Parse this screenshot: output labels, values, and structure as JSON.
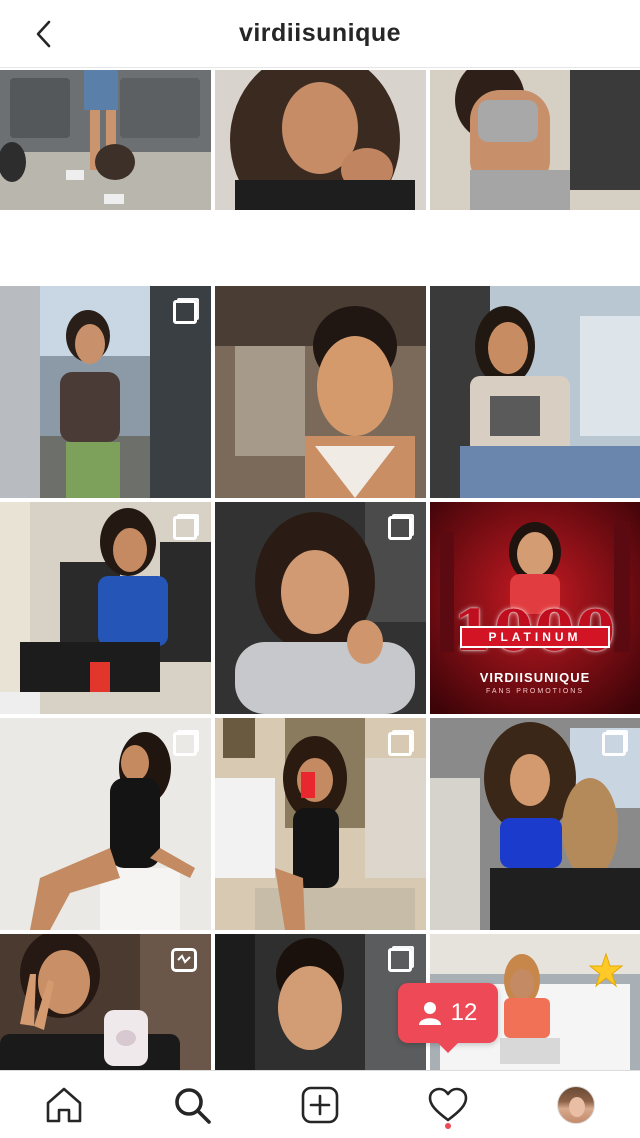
{
  "header": {
    "title": "virdiisunique"
  },
  "posts": [
    {
      "scene": "car-door-legs",
      "badge": "none"
    },
    {
      "scene": "curly-hair-selfie",
      "badge": "none"
    },
    {
      "scene": "gray-tank-top",
      "badge": "none"
    },
    {
      "scene": "truck-crop-top",
      "badge": "multiple"
    },
    {
      "scene": "car-selfie-bun",
      "badge": "none"
    },
    {
      "scene": "car-graphic-tee",
      "badge": "none"
    },
    {
      "scene": "blue-jersey-chair",
      "badge": "multiple"
    },
    {
      "scene": "gray-hoodie-car",
      "badge": "multiple"
    },
    {
      "scene": "platinum-poster",
      "badge": "none"
    },
    {
      "scene": "black-bodysuit",
      "badge": "multiple"
    },
    {
      "scene": "mirror-selfie-room",
      "badge": "multiple"
    },
    {
      "scene": "car-blue-top",
      "badge": "multiple"
    },
    {
      "scene": "peace-sign",
      "badge": "igtv"
    },
    {
      "scene": "car-red-top",
      "badge": "multiple"
    },
    {
      "scene": "orange-top-couch",
      "badge": "none"
    }
  ],
  "poster": {
    "big_text": "1000",
    "platinum": "PLATINUM",
    "name": "VIRDIISUNIQUE",
    "sub": "FANS PROMOTIONS"
  },
  "follow_notification": {
    "icon": "person-icon",
    "count": "12"
  },
  "bottom_nav": {
    "items": [
      "home-icon",
      "search-icon",
      "new-post-icon",
      "activity-heart-icon",
      "profile-avatar"
    ]
  },
  "colors": {
    "accent_red": "#ed4956",
    "text": "#262626"
  }
}
